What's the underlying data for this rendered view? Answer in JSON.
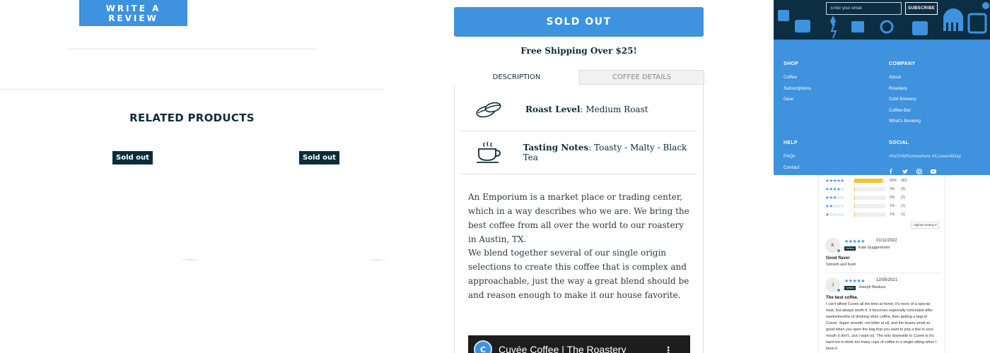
{
  "reviews_section": {
    "write_review_label": "WRITE A REVIEW"
  },
  "related": {
    "title": "RELATED PRODUCTS",
    "products": [
      {
        "badge": "Sold out"
      },
      {
        "badge": "Sold out"
      }
    ]
  },
  "product": {
    "sold_out_label": "SOLD OUT",
    "free_shipping": "Free Shipping Over $25!",
    "tabs": [
      {
        "label": "DESCRIPTION",
        "active": true
      },
      {
        "label": "COFFEE DETAILS",
        "active": false
      }
    ],
    "attributes": [
      {
        "icon": "coffee-beans-icon",
        "label": "Roast Level",
        "value": ": Medium Roast"
      },
      {
        "icon": "coffee-cup-icon",
        "label": "Tasting Notes",
        "value": ": Toasty - Malty - Black Tea"
      }
    ],
    "description": [
      "An Emporium is a market place or trading center, which in a way describes who we are. We bring the best coffee from all over the world to our roastery in Austin, TX.",
      "We blend together several of our single origin selections to create this coffee that is complex and approachable, just the way a great blend should be and reason enough to make it our house favorite."
    ],
    "video": {
      "title": "Cuvée Coffee | The Roastery",
      "menu": "⋮"
    }
  },
  "footer": {
    "email_placeholder": "Enter your email",
    "subscribe_label": "SUBSCRIBE",
    "shop": {
      "heading": "SHOP",
      "links": [
        "Coffee",
        "Subscriptions",
        "Gear"
      ]
    },
    "company": {
      "heading": "COMPANY",
      "links": [
        "About",
        "Roastery",
        "Cold Brewery",
        "Coffee Bar",
        "What's Brewing"
      ]
    },
    "help": {
      "heading": "HELP",
      "links": [
        "FAQs",
        "Contact"
      ]
    },
    "social": {
      "heading": "SOCIAL",
      "hashtags": "#ItsSAMSomewhere #CuveeAllDay",
      "icons": [
        "facebook-icon",
        "twitter-icon",
        "instagram-icon",
        "youtube-icon"
      ]
    },
    "colors": {
      "background": "#3e92de",
      "banner": "#0c2e42"
    }
  },
  "reviews": {
    "histogram": [
      {
        "stars": "★★★★★",
        "fraction": 0.92,
        "pct": "92%",
        "count": "(82)"
      },
      {
        "stars": "★★★★☆",
        "fraction": 0.03,
        "pct": "3%",
        "count": "(3)"
      },
      {
        "stars": "★★★☆☆",
        "fraction": 0.02,
        "pct": "2%",
        "count": "(2)"
      },
      {
        "stars": "★★☆☆☆",
        "fraction": 0.01,
        "pct": "1%",
        "count": "(1)"
      },
      {
        "stars": "★☆☆☆☆",
        "fraction": 0.01,
        "pct": "1%",
        "count": "(1)"
      }
    ],
    "sort_label": "Highest Rating ▾",
    "verified_label": "Verified",
    "items": [
      {
        "initial": "K",
        "stars": "★★★★★",
        "date": "01/11/2022",
        "name": "Kate Guggenheim",
        "title": "Good flavor",
        "body": "Smooth and fresh"
      },
      {
        "initial": "J",
        "stars": "★★★★★",
        "date": "12/05/2021",
        "name": "Joseph Bastura",
        "title": "The best coffee.",
        "body": "I can't afford Cuvee all the time at home; it's more of a special treat, but always worth it. It becomes especially noticeable after weeks/months of drinking other coffee, then getting a bag of Cuvee. Super smooth, not bitter at all, and the beans smell so good when you open the bag that you want to pop a few in your mouth (I don't...but I want to). The only downside to Cuvee is it's hard not to drink too many cups of coffee in a single sitting when I brew it."
      }
    ]
  },
  "accent_color": "#3e92de",
  "dark_color": "#0c2c3c"
}
